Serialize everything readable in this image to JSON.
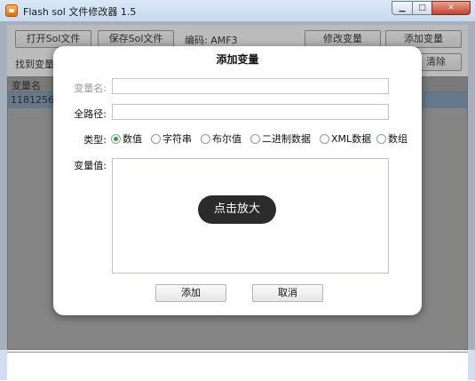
{
  "window": {
    "title": "Flash sol 文件修改器 1.5",
    "controls": {
      "minimize": "▁",
      "maximize": "□",
      "close": "✕"
    }
  },
  "toolbar": {
    "open_label": "打开Sol文件",
    "save_label": "保存Sol文件",
    "encoding_label": "编码: AMF3",
    "modify_label": "修改变量",
    "add_label": "添加变量",
    "find_label": "找到变量",
    "clear_label": "清除"
  },
  "list": {
    "column_header": "变量名",
    "rows": [
      "11812562"
    ]
  },
  "dialog": {
    "title": "添加变量",
    "name_label": "变量名:",
    "path_label": "全路径:",
    "type_label": "类型:",
    "value_label": "变量值:",
    "name_value": "",
    "path_value": "",
    "types": [
      "数值",
      "字符串",
      "布尔值",
      "二进制数据",
      "XML数据",
      "数组"
    ],
    "selected_type": "数值",
    "ok_label": "添加",
    "cancel_label": "取消"
  },
  "zoom_hint": "点击放大",
  "colors": {
    "selected_radio": "#2fa33d",
    "title_bar": "#cfdff1",
    "close_button": "#c7412a"
  }
}
